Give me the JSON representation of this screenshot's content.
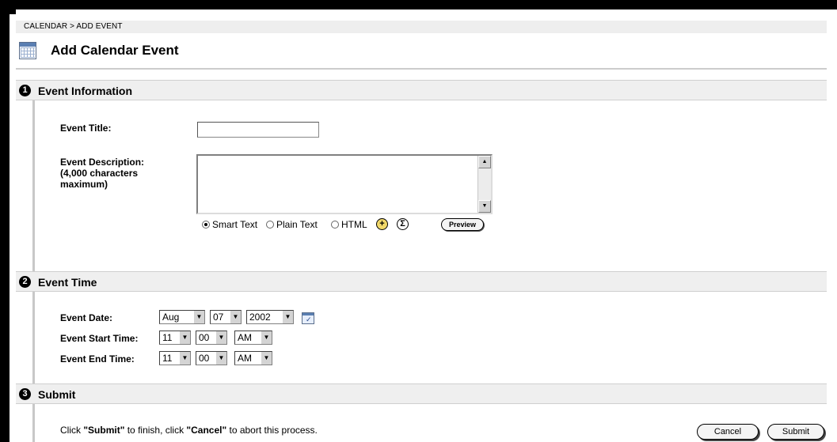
{
  "breadcrumb": "CALENDAR > ADD EVENT",
  "page_title": "Add Calendar Event",
  "sections": [
    {
      "number": "1",
      "title": "Event Information"
    },
    {
      "number": "2",
      "title": "Event Time"
    },
    {
      "number": "3",
      "title": "Submit"
    }
  ],
  "event_info": {
    "title_label": "Event Title:",
    "title_value": "",
    "description_label_1": "Event Description:",
    "description_label_2": "(4,000 characters",
    "description_label_3": "maximum)",
    "description_value": "",
    "format_options": [
      "Smart Text",
      "Plain Text",
      "HTML"
    ],
    "selected_format": "Smart Text",
    "preview_label": "Preview",
    "add_icon": "plus-circle-icon",
    "math_icon": "sigma-icon"
  },
  "event_time": {
    "date_label": "Event Date:",
    "start_label": "Event Start Time:",
    "end_label": "Event End Time:",
    "date_month": "Aug",
    "date_day": "07",
    "date_year": "2002",
    "start_hour": "11",
    "start_minute": "00",
    "start_ampm": "AM",
    "end_hour": "11",
    "end_minute": "00",
    "end_ampm": "AM",
    "calendar_icon": "calendar-picker-icon"
  },
  "submit": {
    "instr_1": "Click ",
    "instr_2": "\"Submit\"",
    "instr_3": " to finish, click ",
    "instr_4": "\"Cancel\"",
    "instr_5": " to abort this process.",
    "cancel_label": "Cancel",
    "submit_label": "Submit"
  },
  "colors": {
    "section_bar": "#efefef",
    "breadcrumb_bar": "#eeeeee",
    "frame": "#000000"
  }
}
